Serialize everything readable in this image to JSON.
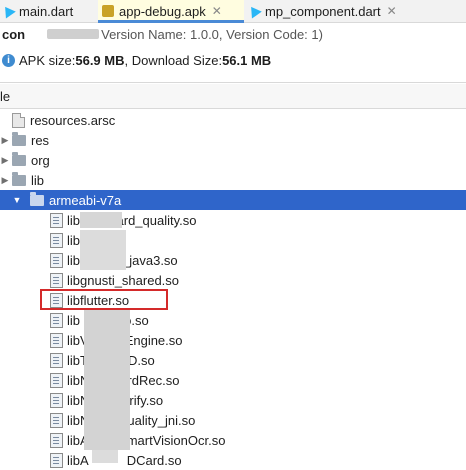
{
  "tabs": [
    {
      "label": "main.dart",
      "icon": "dart-icon",
      "active": false
    },
    {
      "label": "app-debug.apk",
      "icon": "apk-icon",
      "active": true
    },
    {
      "label": "mp_component.dart",
      "icon": "dart-icon",
      "active": false
    }
  ],
  "header": {
    "app_id_partial": "con",
    "version_text": "Version Name: 1.0.0, Version Code: 1)"
  },
  "size_info": {
    "prefix": "APK size: ",
    "apk_size": "56.9 MB",
    "middle": ", Download Size: ",
    "download_size": "56.1 MB"
  },
  "column_header": "le",
  "tree": [
    {
      "name": "resources.arsc",
      "type": "file"
    },
    {
      "name": "res",
      "type": "folder",
      "expanded": false
    },
    {
      "name": "org",
      "type": "folder",
      "expanded": false
    },
    {
      "name": "lib",
      "type": "folder",
      "expanded": false
    },
    {
      "name": "armeabi-v7a",
      "type": "folder",
      "expanded": true,
      "selected": true
    },
    {
      "name": "lib",
      "name_tail": "card_quality.so",
      "type": "so"
    },
    {
      "name": "lib",
      "name_tail": "",
      "type": "so"
    },
    {
      "name": "lib",
      "name_tail": "_java3.so",
      "type": "so"
    },
    {
      "name": "lib",
      "name_tail": "gnusti_shared.so",
      "type": "so"
    },
    {
      "name": "libflutter.so",
      "name_tail": "",
      "type": "so",
      "highlighted": true
    },
    {
      "name": "lib",
      "name_tail": "crypto.so",
      "type": "so"
    },
    {
      "name": "libV",
      "name_tail": "Engine.so",
      "type": "so"
    },
    {
      "name": "libT",
      "name_tail": "D.so",
      "type": "so"
    },
    {
      "name": "libN",
      "name_tail": "rdRec.so",
      "type": "so"
    },
    {
      "name": "libN",
      "name_tail": "rify.so",
      "type": "so"
    },
    {
      "name": "libN",
      "name_tail": "uality_jni.so",
      "type": "so"
    },
    {
      "name": "libA",
      "name_tail": "martVisionOcr.so",
      "type": "so"
    },
    {
      "name": "libA",
      "name_tail": "DCard.so",
      "type": "so"
    }
  ],
  "colors": {
    "selection": "#2f65ca",
    "highlight_box": "#d42a2a",
    "active_tab_underline": "#4a8ad6"
  }
}
